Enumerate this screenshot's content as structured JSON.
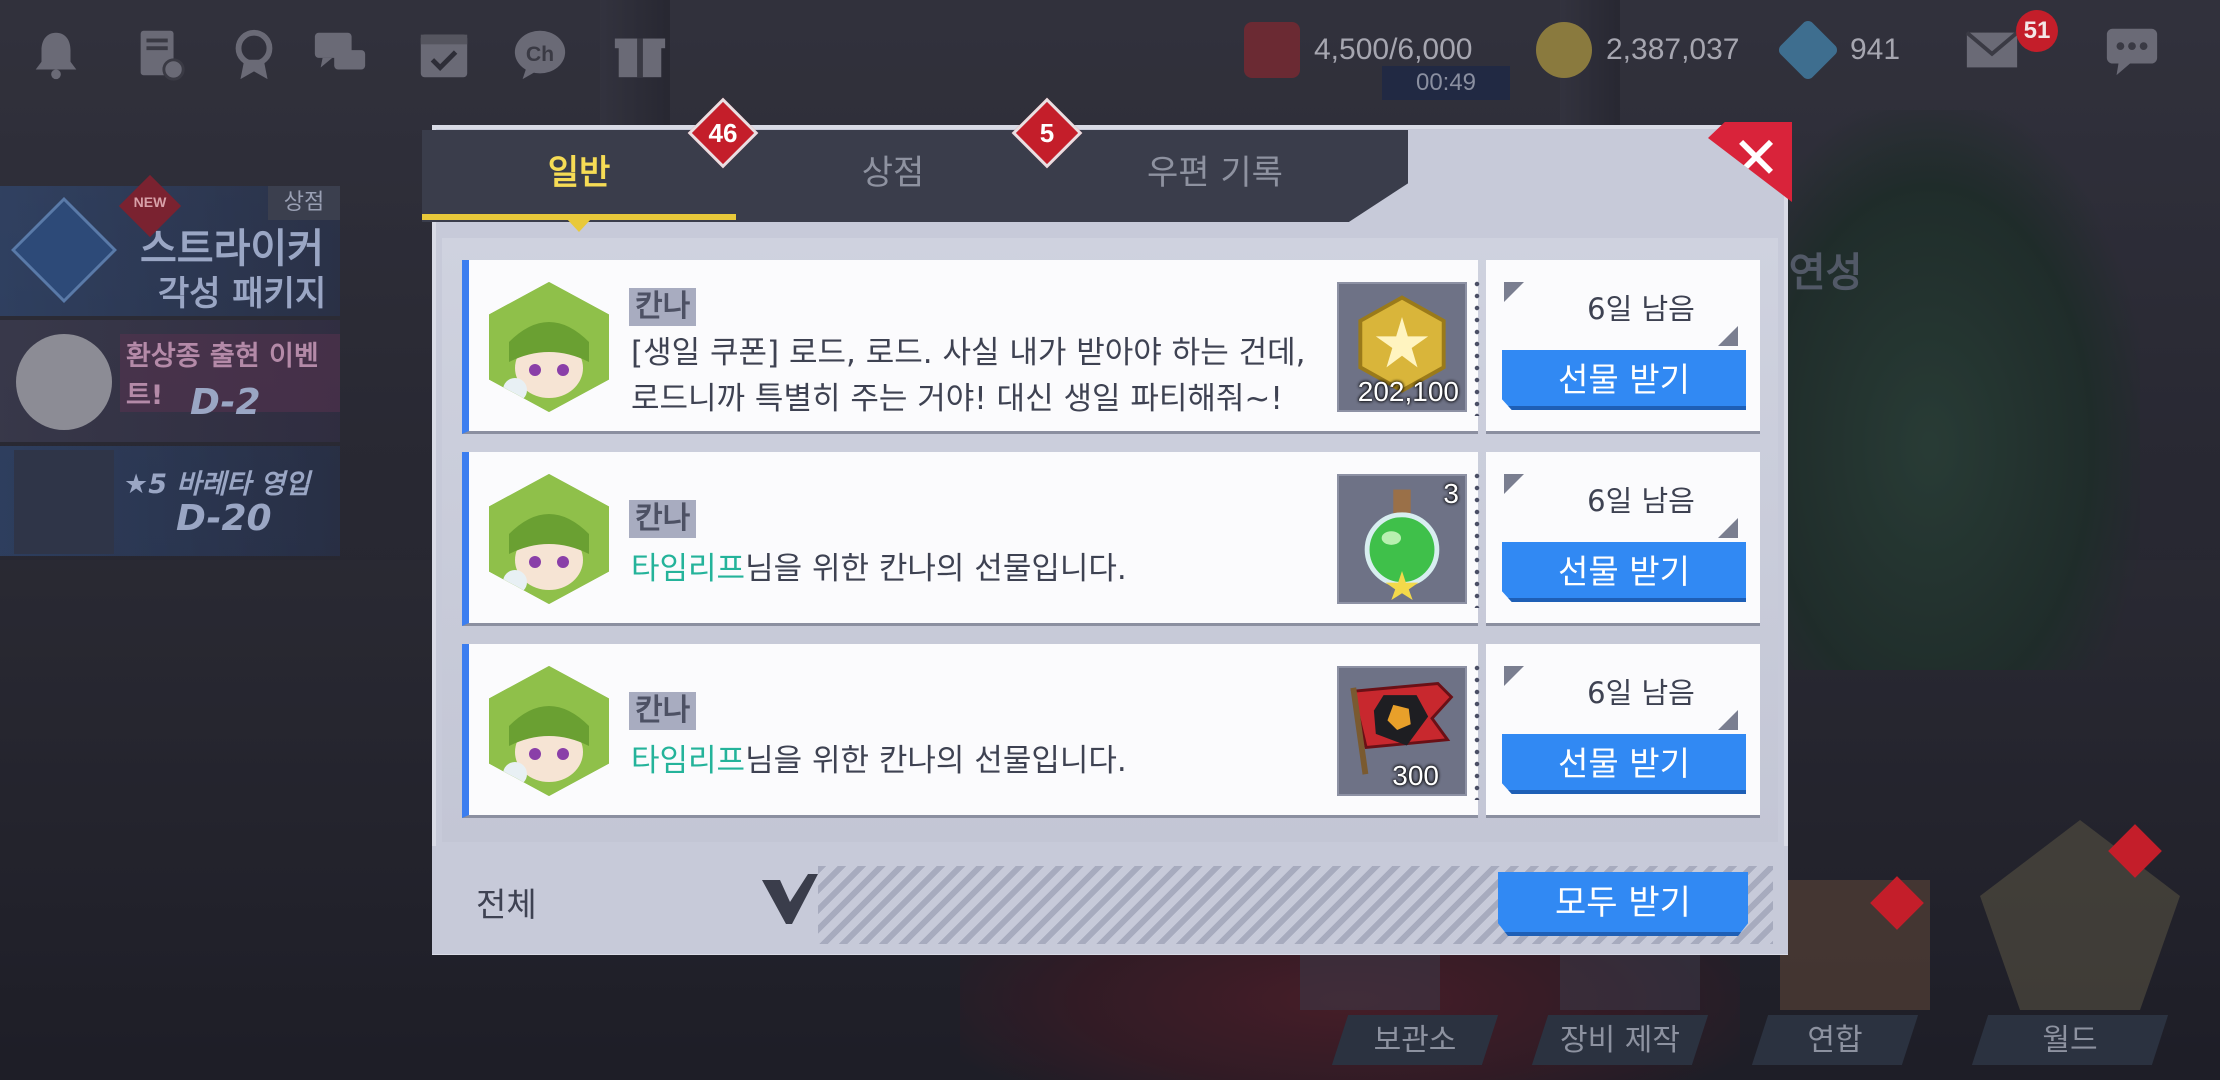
{
  "topbar": {
    "icons": [
      "bell-icon",
      "notes-gear-icon",
      "medal-icon",
      "chat-icon",
      "calendar-check-icon",
      "channel-icon",
      "gift-icon"
    ],
    "channel_label": "Ch",
    "stamina": "4,500/6,000",
    "stamina_timer": "00:49",
    "gold": "2,387,037",
    "gems": "941",
    "mail_badge": "51"
  },
  "left_banners": {
    "shop_tag": "상점",
    "new_tag": "NEW",
    "banner1_line1": "스트라이커",
    "banner1_line2": "각성 패키지",
    "banner2_title": "환상종 출현 이벤트!",
    "banner2_dday": "D-2",
    "banner3_title": "★5 바레타 영입",
    "banner3_dday": "D-20"
  },
  "background_text": {
    "right_label": "I 연성"
  },
  "modal": {
    "tabs": [
      {
        "label": "일반",
        "badge": "46",
        "active": true
      },
      {
        "label": "상점",
        "badge": "5",
        "active": false
      },
      {
        "label": "우편 기록",
        "badge": "",
        "active": false
      }
    ],
    "close_label": "✕",
    "mails": [
      {
        "sender": "칸나",
        "line1": "[생일 쿠폰] 로드, 로드. 사실 내가 받아야 하는 건데,",
        "line2": "로드니까 특별히 주는 거야! 대신 생일 파티해줘~!",
        "item_icon": "gold-coin-icon",
        "item_qty": "202,100",
        "remaining": "6일 남음",
        "button": "선물 받기"
      },
      {
        "sender": "칸나",
        "highlight": "타임리프",
        "line1_rest": "님을 위한 칸나의 선물입니다.",
        "item_icon": "green-potion-icon",
        "item_qty": "3",
        "remaining": "6일 남음",
        "button": "선물 받기"
      },
      {
        "sender": "칸나",
        "highlight": "타임리프",
        "line1_rest": "님을 위한 칸나의 선물입니다.",
        "item_icon": "stamina-flag-icon",
        "item_qty": "300",
        "remaining": "6일 남음",
        "button": "선물 받기"
      }
    ],
    "filter_label": "전체",
    "claim_all": "모두 받기"
  },
  "bottom_menu": {
    "items": [
      "보관소",
      "장비 제작",
      "연합",
      "월드"
    ]
  },
  "colors": {
    "accent_blue": "#3189f3",
    "tab_active": "#f6dc55",
    "badge_red": "#c41e2a",
    "highlight_teal": "#24b39a"
  }
}
